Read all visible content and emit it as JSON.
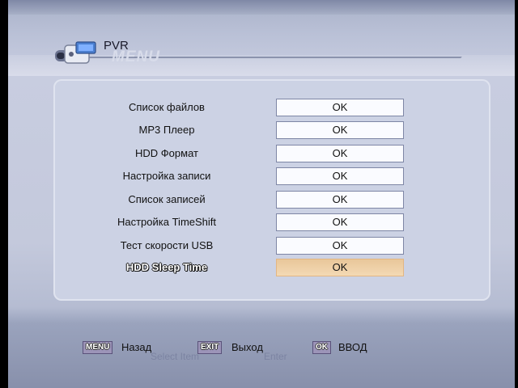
{
  "header": {
    "title": "PVR",
    "ghost_title": "MENU",
    "icon": "camcorder-icon"
  },
  "menu": {
    "items": [
      {
        "label": "Список файлов",
        "value": "OK"
      },
      {
        "label": "MP3 Плеер",
        "value": "OK"
      },
      {
        "label": "HDD Формат",
        "value": "OK"
      },
      {
        "label": "Настройка записи",
        "value": "OK"
      },
      {
        "label": "Список записей",
        "value": "OK"
      },
      {
        "label": "Настройка TimeShift",
        "value": "OK"
      },
      {
        "label": "Тест скорости USB",
        "value": "OK"
      },
      {
        "label": "HDD Sleep Time",
        "value": "OK",
        "selected": true
      }
    ]
  },
  "footer": {
    "menu_key": "MENU",
    "menu_label": "Назад",
    "exit_key": "EXIT",
    "exit_label": "Выход",
    "ok_key": "OK",
    "ok_label": "ВВОД",
    "ghost_select": "Select Item",
    "ghost_enter": "Enter"
  },
  "colors": {
    "highlight": "#f0d2a8",
    "panel": "#ccd2e4",
    "key_bg": "#9c94b8"
  }
}
